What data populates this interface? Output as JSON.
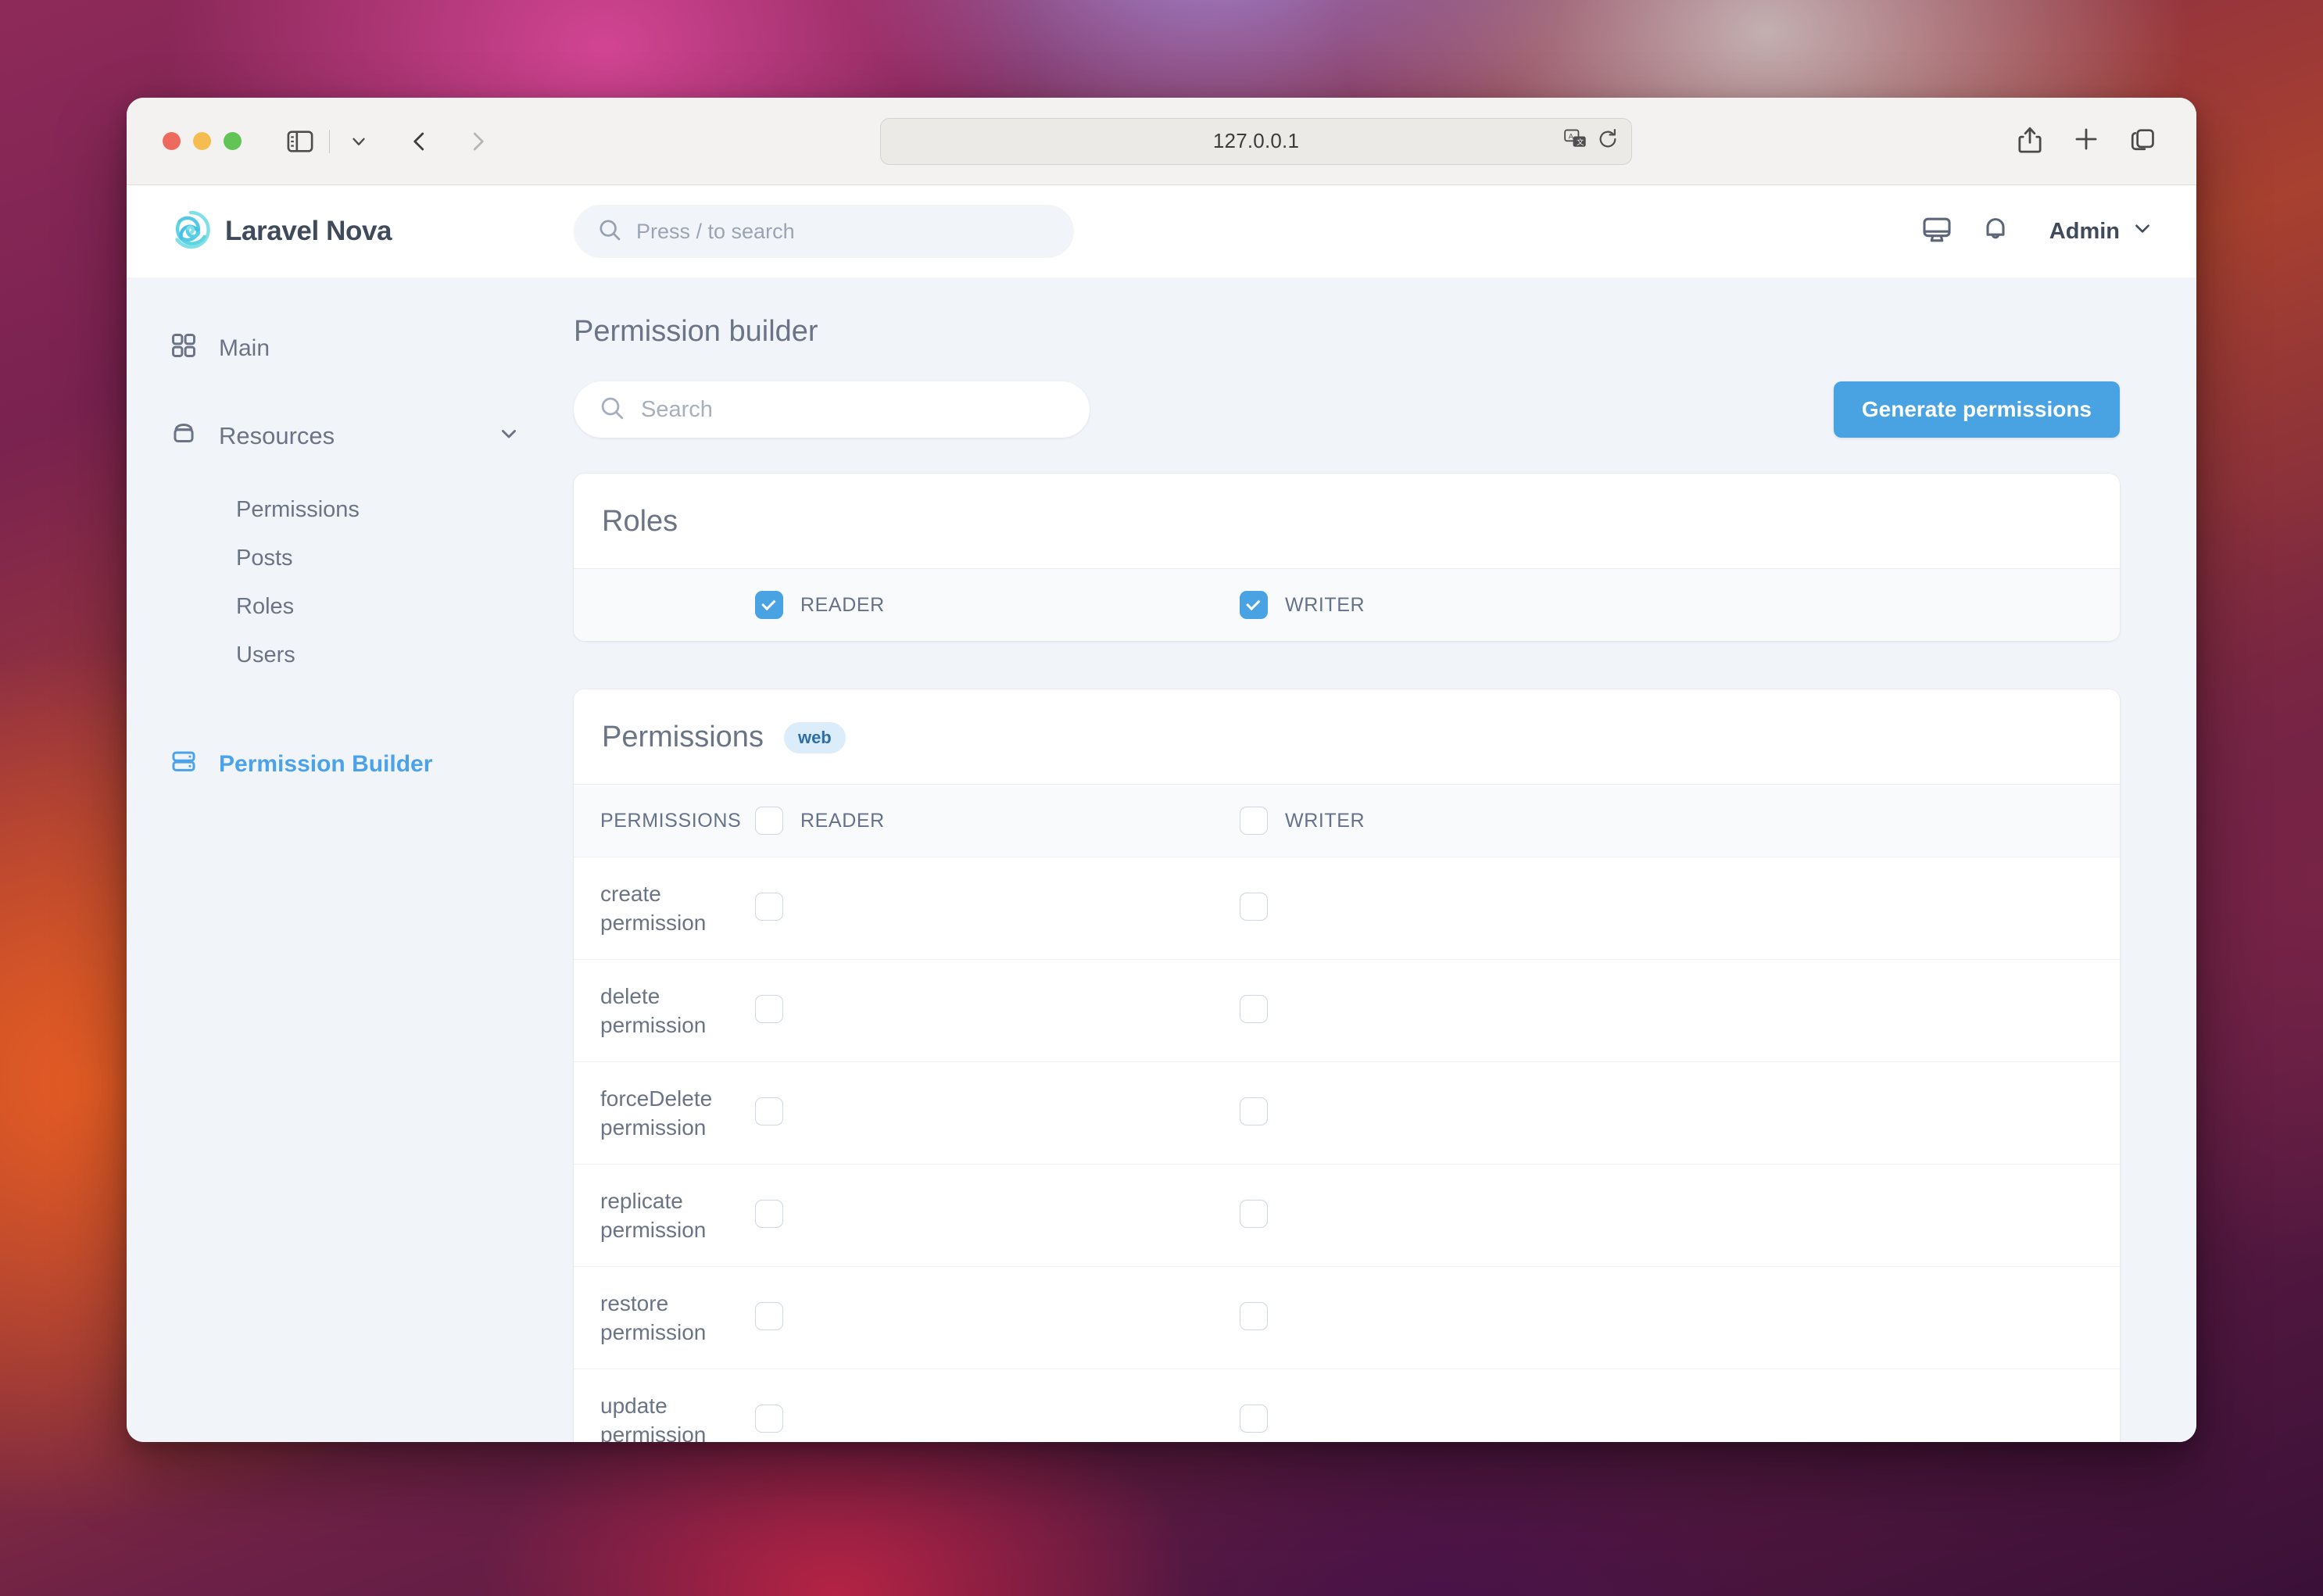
{
  "browser": {
    "url": "127.0.0.1",
    "icons": {
      "sidebar_toggle": "sidebar-toggle-icon",
      "tab_overview_chevron": "chevron-down-icon",
      "back": "chevron-left-icon",
      "forward": "chevron-right-icon",
      "translate": "translate-icon",
      "reload": "reload-icon",
      "share": "share-icon",
      "new_tab": "plus-icon",
      "tab_overview": "tabs-icon"
    }
  },
  "header": {
    "brand": "Laravel Nova",
    "search_placeholder": "Press / to search",
    "user_menu": "Admin",
    "icons": {
      "logo": "nova-spiral-logo",
      "search": "search-icon",
      "screen": "monitor-icon",
      "notifications": "bell-icon",
      "chevron": "chevron-down-icon"
    }
  },
  "sidebar": {
    "main": {
      "label": "Main",
      "icon": "grid-icon"
    },
    "resources": {
      "label": "Resources",
      "icon": "database-icon",
      "chevron": "chevron-down-icon"
    },
    "resource_items": [
      {
        "label": "Permissions"
      },
      {
        "label": "Posts"
      },
      {
        "label": "Roles"
      },
      {
        "label": "Users"
      }
    ],
    "permission_builder": {
      "label": "Permission Builder",
      "icon": "server-icon",
      "active": true
    }
  },
  "main": {
    "page_title": "Permission builder",
    "search_placeholder": "Search",
    "search_value": "",
    "generate_button": "Generate permissions",
    "roles_card": {
      "title": "Roles",
      "roles": [
        {
          "label": "READER",
          "checked": true
        },
        {
          "label": "WRITER",
          "checked": true
        }
      ]
    },
    "permissions_card": {
      "title": "Permissions",
      "badge": "web",
      "columns": {
        "name": "PERMISSIONS",
        "reader": "READER",
        "writer": "WRITER",
        "reader_all_checked": false,
        "writer_all_checked": false
      },
      "rows": [
        {
          "name_line1": "create",
          "name_line2": "permission",
          "reader": false,
          "writer": false
        },
        {
          "name_line1": "delete",
          "name_line2": "permission",
          "reader": false,
          "writer": false
        },
        {
          "name_line1": "forceDelete",
          "name_line2": "permission",
          "reader": false,
          "writer": false
        },
        {
          "name_line1": "replicate",
          "name_line2": "permission",
          "reader": false,
          "writer": false
        },
        {
          "name_line1": "restore",
          "name_line2": "permission",
          "reader": false,
          "writer": false
        },
        {
          "name_line1": "update",
          "name_line2": "permission",
          "reader": false,
          "writer": false
        }
      ]
    }
  },
  "colors": {
    "accent": "#49a3e3",
    "badge_bg": "#dbecfb",
    "badge_text": "#2d6ea4",
    "text_muted": "#6b7486",
    "app_bg": "#f1f4f9",
    "logo_teal": "#5ed4e0"
  }
}
